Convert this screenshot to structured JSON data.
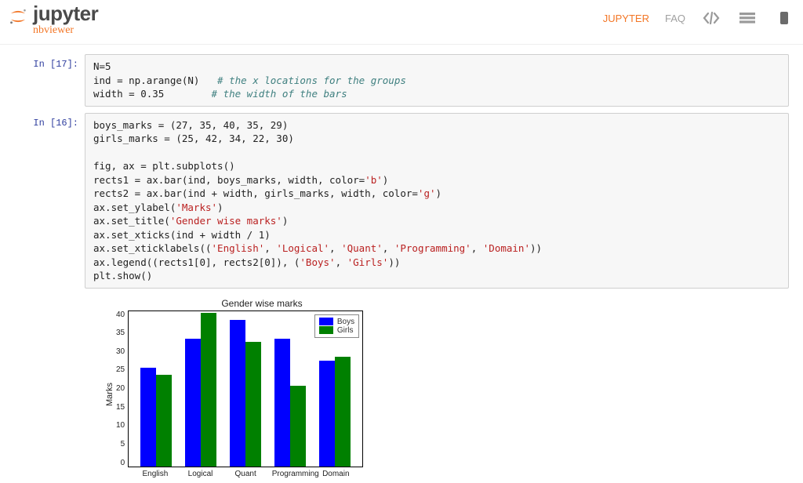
{
  "header": {
    "logo_top": "jupyter",
    "logo_bottom": "nbviewer",
    "nav_jupyter": "JUPYTER",
    "nav_faq": "FAQ"
  },
  "cells": {
    "c17": {
      "prompt": "In [17]:",
      "lines": {
        "l0": "N=5",
        "l1a": "ind = np.arange(N)   ",
        "l1c": "# the x locations for the groups",
        "l2a": "width = 0.35        ",
        "l2c": "# the width of the bars"
      }
    },
    "c16": {
      "prompt": "In [16]:",
      "lines": {
        "l0": "boys_marks = (27, 35, 40, 35, 29)",
        "l1": "girls_marks = (25, 42, 34, 22, 30)",
        "l2": "",
        "l3": "fig, ax = plt.subplots()",
        "l4a": "rects1 = ax.bar(ind, boys_marks, width, color=",
        "l4s": "'b'",
        "l4b": ")",
        "l5a": "rects2 = ax.bar(ind + width, girls_marks, width, color=",
        "l5s": "'g'",
        "l5b": ")",
        "l6a": "ax.set_ylabel(",
        "l6s": "'Marks'",
        "l6b": ")",
        "l7a": "ax.set_title(",
        "l7s": "'Gender wise marks'",
        "l7b": ")",
        "l8": "ax.set_xticks(ind + width / 1)",
        "l9a": "ax.set_xticklabels((",
        "l9s1": "'English'",
        "l9c1": ", ",
        "l9s2": "'Logical'",
        "l9c2": ", ",
        "l9s3": "'Quant'",
        "l9c3": ", ",
        "l9s4": "'Programming'",
        "l9c4": ", ",
        "l9s5": "'Domain'",
        "l9b": "))",
        "l10a": "ax.legend((rects1[0], rects2[0]), (",
        "l10s1": "'Boys'",
        "l10c1": ", ",
        "l10s2": "'Girls'",
        "l10b": "))",
        "l11": "plt.show()"
      }
    }
  },
  "chart_data": {
    "type": "bar",
    "title": "Gender wise marks",
    "ylabel": "Marks",
    "xlabel": "",
    "categories": [
      "English",
      "Logical",
      "Quant",
      "Programming",
      "Domain"
    ],
    "series": [
      {
        "name": "Boys",
        "color": "#0000ff",
        "values": [
          27,
          35,
          40,
          35,
          29
        ]
      },
      {
        "name": "Girls",
        "color": "#008000",
        "values": [
          25,
          42,
          34,
          22,
          30
        ]
      }
    ],
    "yticks": [
      0,
      5,
      10,
      15,
      20,
      25,
      30,
      35,
      40
    ],
    "ylim": [
      0,
      43
    ]
  }
}
